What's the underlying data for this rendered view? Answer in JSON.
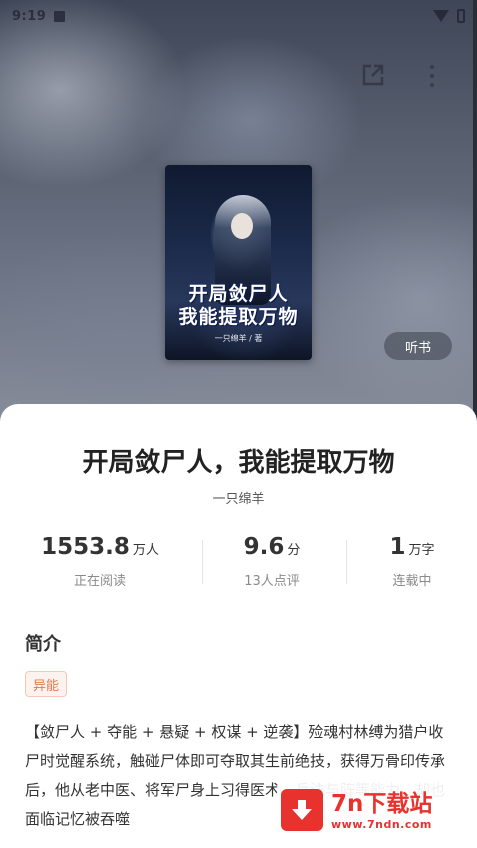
{
  "status_bar": {
    "time": "9:19"
  },
  "header": {
    "share_icon": "share-icon",
    "more_icon": "more-vert-icon"
  },
  "cover": {
    "title_line1": "开局敛尸人",
    "title_line2": "我能提取万物",
    "author_text": "一只绵羊 / 著"
  },
  "listen_button": {
    "label": "听书"
  },
  "book": {
    "title": "开局敛尸人，我能提取万物",
    "author": "一只绵羊"
  },
  "stats": [
    {
      "value": "1553.8",
      "unit": "万人",
      "label": "正在阅读"
    },
    {
      "value": "9.6",
      "unit": "分",
      "label": "13人点评"
    },
    {
      "value": "1",
      "unit": "万字",
      "label": "连载中"
    }
  ],
  "intro": {
    "heading": "简介",
    "tag": "异能",
    "synopsis": "【敛尸人 + 夺能 + 悬疑 + 权谋 + 逆袭】殓魂村林缚为猎户收尸时觉醒系统，触碰尸体即可夺取其生前绝技，获得万骨印传承后，他从老中医、将军尸身上习得医术、兵法与阵等能力，却也面临记忆被吞噬"
  },
  "watermark": {
    "name": "7n下载站",
    "url": "www.7ndn.com"
  },
  "colors": {
    "accent_tag": "#e27a4a",
    "watermark_red": "#e8322d"
  }
}
